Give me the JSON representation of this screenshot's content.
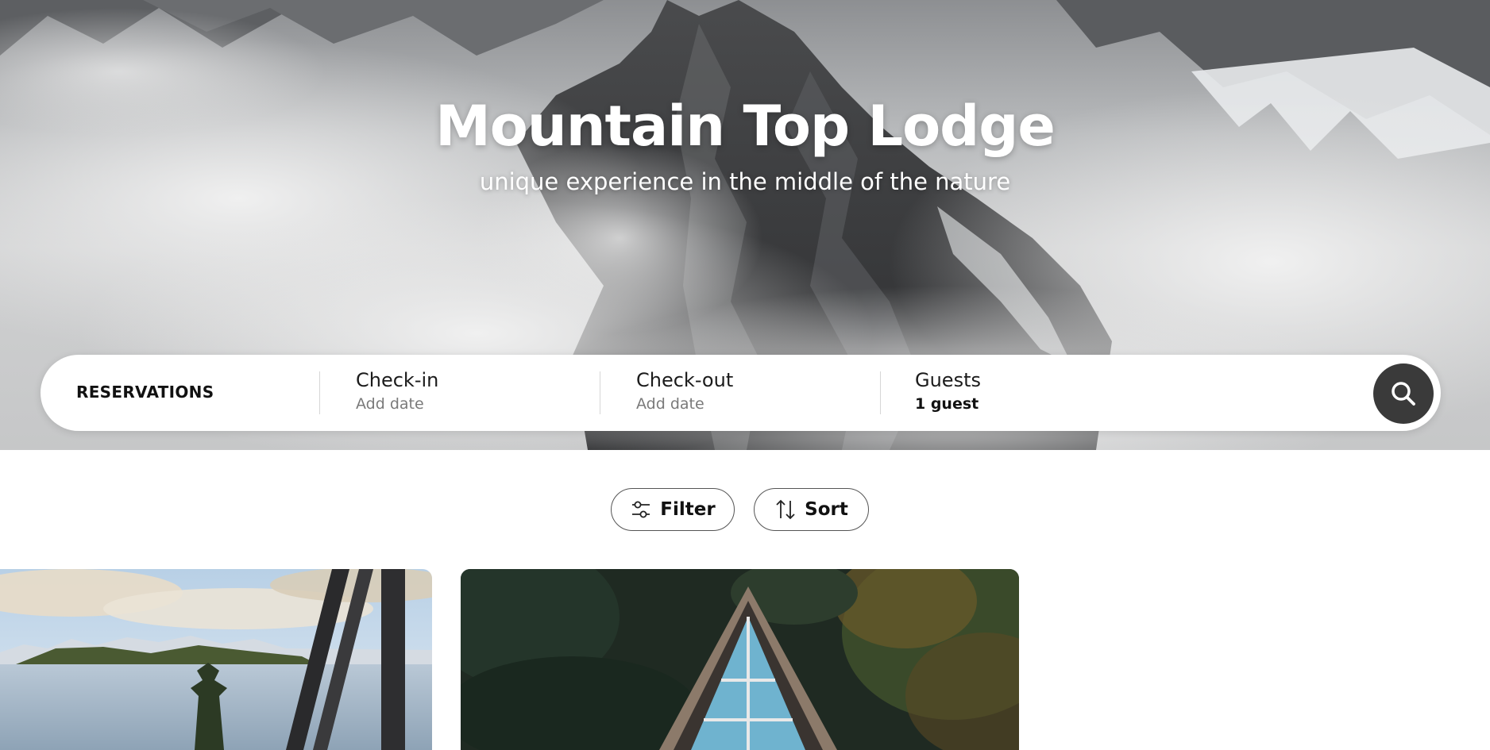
{
  "hero": {
    "title": "Mountain Top Lodge",
    "subtitle": "unique experience in the middle of the nature"
  },
  "reservation": {
    "label": "RESERVATIONS",
    "checkin": {
      "label": "Check-in",
      "value": "Add date"
    },
    "checkout": {
      "label": "Check-out",
      "value": "Add date"
    },
    "guests": {
      "label": "Guests",
      "value": "1 guest"
    },
    "search_icon": "search-icon"
  },
  "controls": {
    "filter": {
      "label": "Filter",
      "icon": "sliders-icon"
    },
    "sort": {
      "label": "Sort",
      "icon": "sort-arrows-icon"
    }
  },
  "colors": {
    "search_button": "#3a3a3a",
    "text": "#111111",
    "muted": "#7a7a7a"
  }
}
